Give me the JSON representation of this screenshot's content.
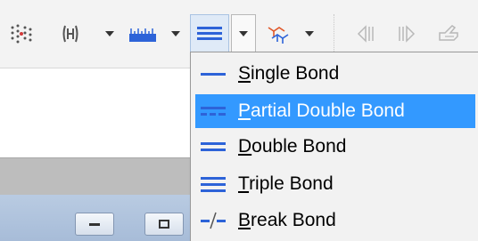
{
  "toolbar": {
    "buttons": [
      {
        "icon": "dotted-atom-grid-icon"
      },
      {
        "icon": "hydrogen-bracket-icon"
      },
      {
        "icon": "chevron-down-icon"
      },
      {
        "icon": "ruler-icon"
      },
      {
        "icon": "chevron-down-icon"
      },
      {
        "icon": "bond-order-icon"
      },
      {
        "icon": "chevron-down-icon"
      },
      {
        "icon": "colorful-molecule-icon"
      },
      {
        "icon": "chevron-down-icon"
      },
      {
        "icon": "step-back-icon"
      },
      {
        "icon": "step-forward-icon"
      },
      {
        "icon": "hand-pointer-icon"
      }
    ],
    "accent": "#2d63d8"
  },
  "bond_menu": {
    "items": [
      {
        "label": "Single Bond",
        "mnemonic": "S",
        "rest": "ingle Bond",
        "icon": "single-bond-icon",
        "highlighted": false
      },
      {
        "label": "Partial Double Bond",
        "mnemonic": "P",
        "rest": "artial Double Bond",
        "icon": "partial-double-bond-icon",
        "highlighted": true
      },
      {
        "label": "Double Bond",
        "mnemonic": "D",
        "rest": "ouble Bond",
        "icon": "double-bond-icon",
        "highlighted": false
      },
      {
        "label": "Triple Bond",
        "mnemonic": "T",
        "rest": "riple Bond",
        "icon": "triple-bond-icon",
        "highlighted": false
      },
      {
        "label": "Break Bond",
        "mnemonic": "B",
        "rest": "reak Bond",
        "icon": "break-bond-icon",
        "highlighted": false
      }
    ],
    "highlight_color": "#3399ff",
    "background_color": "#f2f2f2"
  },
  "window_controls": [
    {
      "icon": "minimize-icon"
    },
    {
      "icon": "restore-icon"
    }
  ]
}
